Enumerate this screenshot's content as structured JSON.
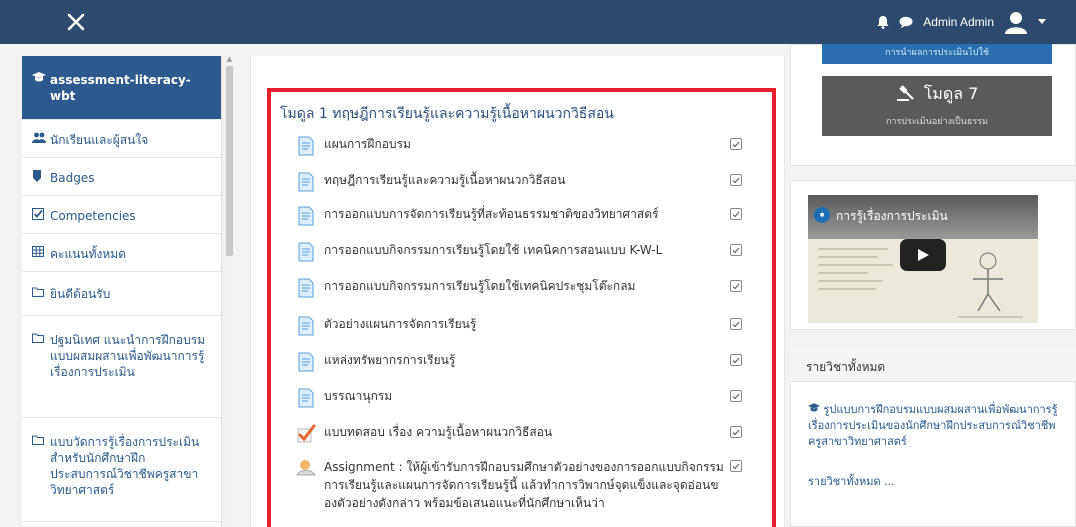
{
  "topbar": {
    "close_icon": "close-icon",
    "bell_icon": "bell-icon",
    "chat_icon": "chat-icon",
    "username": "Admin Admin",
    "avatar_icon": "user-avatar-icon",
    "caret_icon": "caret-down-icon",
    "bg_color": "#2c4a6e"
  },
  "sidebar": {
    "items": [
      {
        "icon": "graduation-cap-icon",
        "label": "assessment-literacy-wbt",
        "active": true
      },
      {
        "icon": "users-icon",
        "label": "นักเรียนและผู้สนใจ"
      },
      {
        "icon": "badge-icon",
        "label": "Badges"
      },
      {
        "icon": "checkbox-icon",
        "label": "Competencies"
      },
      {
        "icon": "table-icon",
        "label": "คะแนนทั้งหมด"
      },
      {
        "icon": "folder-icon",
        "label": "ยินดีต้อนรับ"
      },
      {
        "icon": "folder-icon",
        "label": "ปฐมนิเทศ แนะนำการฝึกอบรมแบบผสมผสานเพื่อพัฒนาการรู้เรื่องการประเมิน"
      },
      {
        "icon": "folder-icon",
        "label": "แบบวัดการรู้เรื่องการประเมินสำหรับนักศึกษาฝึกประสบการณ์วิชาชีพครูสาขาวิทยาศาสตร์"
      }
    ]
  },
  "main": {
    "section_title": "โมดูล 1 ทฤษฎีการเรียนรู้และความรู้เนื้อหาผนวกวิธีสอน",
    "activities": [
      {
        "icon": "page-icon",
        "name": "แผนการฝึกอบรม"
      },
      {
        "icon": "page-icon",
        "name": "ทฤษฎีการเรียนรู้และความรู้เนื้อหาผนวกวิธีสอน"
      },
      {
        "icon": "page-icon",
        "name": "การออกแบบการจัดการเรียนรู้ที่สะท้อนธรรมชาติของวิทยาศาสตร์"
      },
      {
        "icon": "page-icon",
        "name": "การออกแบบกิจกรรมการเรียนรู้โดยใช้ เทคนิคการสอนแบบ K-W-L"
      },
      {
        "icon": "page-icon",
        "name": "การออกแบบกิจกรรมการเรียนรู้โดยใช้เทคนิคประชุมโต๊ะกลม"
      },
      {
        "icon": "page-icon",
        "name": "ตัวอย่างแผนการจัดการเรียนรู้"
      },
      {
        "icon": "page-icon",
        "name": "แหล่งทรัพยากรการเรียนรู้"
      },
      {
        "icon": "page-icon",
        "name": "บรรณานุกรม"
      },
      {
        "icon": "quiz-icon",
        "name": "แบบทดสอบ เรื่อง ความรู้เนื้อหาผนวกวิธีสอน"
      },
      {
        "icon": "assignment-icon",
        "name": "Assignment : ให้ผู้เข้ารับการฝึกอบรมศึกษาตัวอย่างของการออกแบบกิจกรรมการเรียนรู้และแผนการจัดการเรียนรู้นี้ แล้วทำการวิพากษ์จุดแข็งและจุดอ่อนของตัวอย่างดังกล่าว พร้อมข้อเสนอแนะที่นักศึกษาเห็นว่า"
      }
    ],
    "highlight_color": "#e4202a"
  },
  "right": {
    "blue_button_label": "การนำผลการประเมินไปใช้",
    "module7_title": "โมดูล 7",
    "module7_subtitle": "การประเมินอย่างเป็นธรรม",
    "video_title": "การรู้เรื่องการประเมิน",
    "courses_heading": "รายวิชาทั้งหมด",
    "course_link": "รูปแบบการฝึกอบรมแบบผสมผสานเพื่อพัฒนาการรู้เรื่องการประเมินของนักศึกษาฝึกประสบการณ์วิชาชีพครูสาขาวิทยาศาสตร์",
    "all_courses_label": "รายวิชาทั้งหมด ..."
  }
}
